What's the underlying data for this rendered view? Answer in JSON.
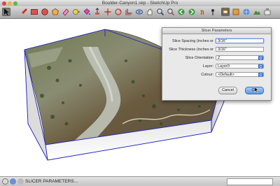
{
  "window": {
    "title": "Boulder-Canyon1.skp - SketchUp Pro"
  },
  "colors": {
    "close": "#e0463d",
    "minimize": "#e8b53a",
    "zoom": "#5bb747",
    "accent": "#3b73d1",
    "box_outline": "#2222cc"
  },
  "toolbar": {
    "tools": [
      "select-arrow-icon",
      "pencil-icon",
      "rectangle-icon",
      "circle-icon",
      "polygon-icon",
      "eraser-icon",
      "tape-measure-icon",
      "paint-bucket-icon",
      "push-pull-icon",
      "move-icon",
      "rotate-icon",
      "offset-icon",
      "orbit-icon",
      "pan-icon",
      "zoom-icon",
      "zoom-extents-icon",
      "previous-view-icon",
      "next-view-icon",
      "walk-icon",
      "position-camera-icon",
      "look-around-icon",
      "section-plane-icon",
      "add-location-icon",
      "toggle-terrain-icon",
      "preview-icon",
      "get-models-icon",
      "share-model-icon",
      "slicer-icon",
      "extension-icon"
    ]
  },
  "dialog": {
    "title": "Slicer Parameters",
    "spacing": {
      "label": "Slice Spacing (inches or",
      "value": "3/16\""
    },
    "thickness": {
      "label": "Slice Thickness (inches or",
      "value": "3/16\""
    },
    "orientation": {
      "label": "Slice Orientation",
      "value": "Z"
    },
    "layer": {
      "label": "Layer:",
      "value": "Layer0"
    },
    "colour": {
      "label": "Colour:",
      "value": "<Default>"
    },
    "cancel_label": "Cancel",
    "ok_label": "OK"
  },
  "status": {
    "text": "SLICER PARAMETERS..."
  }
}
